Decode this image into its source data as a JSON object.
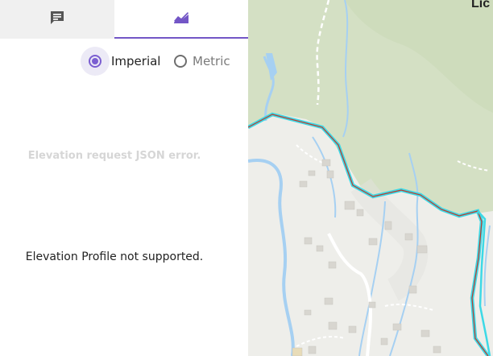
{
  "tabs": [
    {
      "name": "Comments",
      "icon": "comment-icon",
      "active": false
    },
    {
      "name": "Elevation",
      "icon": "elevation-chart-icon",
      "active": true
    }
  ],
  "units": {
    "options": [
      "Imperial",
      "Metric"
    ],
    "selected": "Imperial"
  },
  "messages": {
    "error": "Elevation request JSON error.",
    "unsupported": "Elevation Profile not supported."
  },
  "map": {
    "place_label": "Lic",
    "colors": {
      "forest": "#d4e0c4",
      "water": "#a6d0f2",
      "route_outline": "#3dd9e6",
      "route_line": "#c0392b"
    }
  },
  "colors": {
    "accent": "#7356c6"
  }
}
